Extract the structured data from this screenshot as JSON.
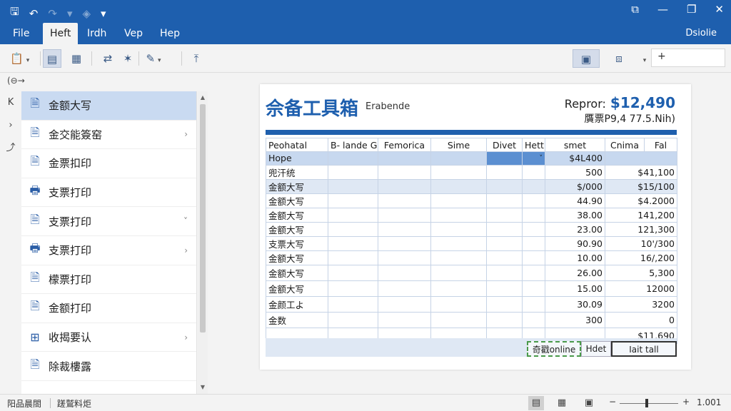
{
  "qat": {
    "save": "🖫",
    "undo": "↶",
    "redo": "↷",
    "dropdown": "▾",
    "customize": "▾"
  },
  "window": {
    "restore": "⧉",
    "minimize": "—",
    "maximize": "❐",
    "close": "✕"
  },
  "menu": {
    "items": [
      "File",
      "Heft",
      "Irdh",
      "Vep",
      "Hep"
    ],
    "user": "Dsiolie"
  },
  "back": "(⊖→",
  "left_strip": [
    "K",
    "›",
    "⤴"
  ],
  "sidebar": {
    "items": [
      {
        "label": "金额大写",
        "icon": "document-icon",
        "chevron": ""
      },
      {
        "label": "金交能簽窑",
        "icon": "document-icon",
        "chevron": "›"
      },
      {
        "label": "金票扣印",
        "icon": "document-icon",
        "chevron": ""
      },
      {
        "label": "支票打印",
        "icon": "printer-icon",
        "chevron": ""
      },
      {
        "label": "支票打印",
        "icon": "document-icon",
        "chevron": "˅"
      },
      {
        "label": "支票打印",
        "icon": "printer-icon",
        "chevron": "›"
      },
      {
        "label": "檬票打印",
        "icon": "document-icon",
        "chevron": ""
      },
      {
        "label": "金额打印",
        "icon": "document-icon",
        "chevron": ""
      },
      {
        "label": "收揭要认",
        "icon": "grid-icon",
        "chevron": "›"
      },
      {
        "label": "除裁樓露",
        "icon": "document-icon",
        "chevron": ""
      }
    ]
  },
  "doc": {
    "title": "佘备工具箱",
    "subtitle": "Erabende",
    "report_label": "Repror:",
    "report_value": "$12,490",
    "note": "贋票P9,4 77.5.Nih)",
    "headers": [
      "Peohatal",
      "B- lande Grafe",
      "Femorica",
      "Sime",
      "Divet",
      "Hett",
      "smet",
      "Cnima",
      "Fal"
    ],
    "rows": [
      {
        "cls": "hl",
        "label": "Hope",
        "amount": "$4L400",
        "total": "",
        "arrow": "˅"
      },
      {
        "cls": "",
        "label": "兜汗统",
        "amount": "500",
        "total": "$41,100"
      },
      {
        "cls": "sub",
        "label": "金额大写",
        "amount": "$/000",
        "total": "$15/100"
      },
      {
        "cls": "",
        "label": "金额大写",
        "amount": "44.90",
        "total": "$4.2000"
      },
      {
        "cls": "",
        "label": "金额大写",
        "amount": "38.00",
        "total": "141,200"
      },
      {
        "cls": "",
        "label": "金额大写",
        "amount": "23.00",
        "total": "121,300"
      },
      {
        "cls": "",
        "label": "支票大写",
        "amount": "90.90",
        "total": "10'/300"
      },
      {
        "cls": "",
        "label": "金额大写",
        "amount": "10.00",
        "total": "16/,200"
      },
      {
        "cls": "tall",
        "label": "金额大写",
        "amount": "26.00",
        "total": "5,300"
      },
      {
        "cls": "tall",
        "label": "金额大写",
        "amount": "15.00",
        "total": "12000"
      },
      {
        "cls": "tall",
        "label": "金颜工よ",
        "amount": "30.09",
        "total": "3200"
      },
      {
        "cls": "tall",
        "label": "金数",
        "amount": "300",
        "total": "0"
      },
      {
        "cls": "tall",
        "label": "",
        "amount": "",
        "total": "$11,690"
      }
    ],
    "footer": {
      "btn1": "奇戳online",
      "btn2": "Hdet",
      "btn3": "Iait tall"
    }
  },
  "status": {
    "left": "阳品晨閤",
    "middle": "蹉鷲料炬",
    "zoom": "1.001",
    "zoom_minus": "−",
    "zoom_plus": "+"
  }
}
